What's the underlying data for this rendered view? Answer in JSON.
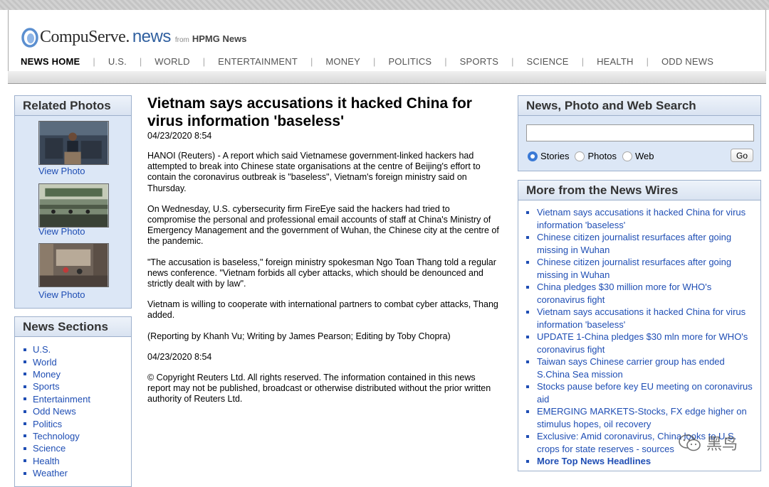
{
  "brand": {
    "name": "CompuServe.",
    "news": "news",
    "from": "from",
    "hpmg": "HPMG News"
  },
  "nav": [
    {
      "label": "NEWS HOME",
      "active": true
    },
    {
      "label": "U.S."
    },
    {
      "label": "WORLD"
    },
    {
      "label": "ENTERTAINMENT"
    },
    {
      "label": "MONEY"
    },
    {
      "label": "POLITICS"
    },
    {
      "label": "SPORTS"
    },
    {
      "label": "SCIENCE"
    },
    {
      "label": "HEALTH"
    },
    {
      "label": "ODD NEWS"
    }
  ],
  "related_photos": {
    "title": "Related Photos",
    "link_label": "View Photo"
  },
  "news_sections": {
    "title": "News Sections",
    "items": [
      "U.S.",
      "World",
      "Money",
      "Sports",
      "Entertainment",
      "Odd News",
      "Politics",
      "Technology",
      "Science",
      "Health",
      "Weather"
    ]
  },
  "article": {
    "headline": "Vietnam says accusations it hacked China for virus information 'baseless'",
    "timestamp": "04/23/2020 8:54",
    "paragraphs": [
      "HANOI (Reuters) - A report which said Vietnamese government-linked hackers had attempted to break into Chinese state organisations at the centre of Beijing's effort to contain the coronavirus outbreak is \"baseless\", Vietnam's foreign ministry said on Thursday.",
      "On Wednesday, U.S. cybersecurity firm FireEye said the hackers had tried to compromise the personal and professional email accounts of staff at China's Ministry of Emergency Management and the government of Wuhan, the Chinese city at the centre of the pandemic.",
      "\"The accusation is baseless,\" foreign ministry spokesman Ngo Toan Thang told a regular news conference. \"Vietnam forbids all cyber attacks, which should be denounced and strictly dealt with by law\".",
      "Vietnam is willing to cooperate with international partners to combat cyber attacks, Thang added.",
      "(Reporting by Khanh Vu; Writing by James Pearson; Editing by Toby Chopra)"
    ],
    "footer_timestamp": "04/23/2020 8:54",
    "copyright": "© Copyright Reuters Ltd. All rights reserved. The information contained in this news report may not be published, broadcast or otherwise distributed without the prior written authority of Reuters Ltd."
  },
  "search": {
    "title": "News, Photo and Web Search",
    "value": "",
    "options": [
      "Stories",
      "Photos",
      "Web"
    ],
    "selected": "Stories",
    "go_label": "Go"
  },
  "wires": {
    "title": "More from the News Wires",
    "items": [
      "Vietnam says accusations it hacked China for virus information 'baseless'",
      "Chinese citizen journalist resurfaces after going missing in Wuhan",
      "Chinese citizen journalist resurfaces after going missing in Wuhan",
      "China pledges $30 million more for WHO's coronavirus fight",
      "Vietnam says accusations it hacked China for virus information 'baseless'",
      "UPDATE 1-China pledges $30 mln more for WHO's coronavirus fight",
      "Taiwan says Chinese carrier group has ended S.China Sea mission",
      "Stocks pause before key EU meeting on coronavirus aid",
      "EMERGING MARKETS-Stocks, FX edge higher on stimulus hopes, oil recovery",
      "Exclusive: Amid coronavirus, China looks to U.S. crops for state reserves - sources"
    ],
    "more_label": "More Top News Headlines"
  },
  "watermark": {
    "text": "黑鸟",
    "icon": "wechat-icon"
  },
  "colors": {
    "link": "#1f4eb4",
    "panel_bg": "#dce7f6",
    "panel_border": "#9db0cc",
    "news_blue": "#2f5f9f"
  }
}
